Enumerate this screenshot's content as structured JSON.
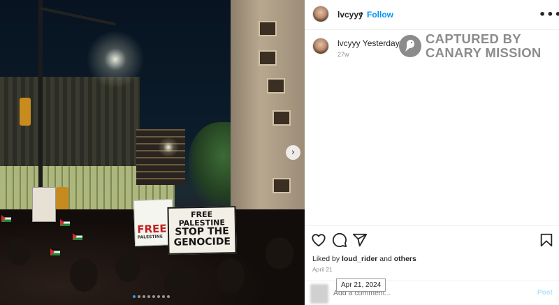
{
  "photo": {
    "signs": {
      "main": [
        "FREE PALESTINE",
        "STOP THE",
        "GENOCIDE"
      ],
      "free": "FREE",
      "free_sub": "PALESTINE"
    },
    "carousel": {
      "count": 8,
      "active_index": 0
    },
    "next_icon": "chevron-right-icon"
  },
  "header": {
    "username": "lvcyyy",
    "separator": "•",
    "follow_label": "Follow",
    "more_icon": "more-horizontal-icon",
    "more_glyph": "•••"
  },
  "caption": {
    "username": "lvcyyy",
    "text": "Yesterday",
    "age": "27w"
  },
  "watermark": {
    "line1": "CAPTURED BY",
    "line2": "CANARY MISSION",
    "logo_icon": "canary-bird-icon"
  },
  "actions": {
    "like_icon": "heart-icon",
    "comment_icon": "comment-bubble-icon",
    "share_icon": "paper-plane-icon",
    "save_icon": "bookmark-icon",
    "liked_prefix": "Liked by",
    "liked_user": "loud_rider",
    "liked_and": "and",
    "liked_others": "others",
    "date": "April 21",
    "date_tooltip": "Apr 21, 2024"
  },
  "comment": {
    "placeholder": "Add a comment...",
    "post_label": "Post"
  },
  "colors": {
    "accent": "#0095f6",
    "post_disabled": "#b2dffc",
    "muted": "#8e8e8e",
    "watermark": "#8c8c8c"
  }
}
